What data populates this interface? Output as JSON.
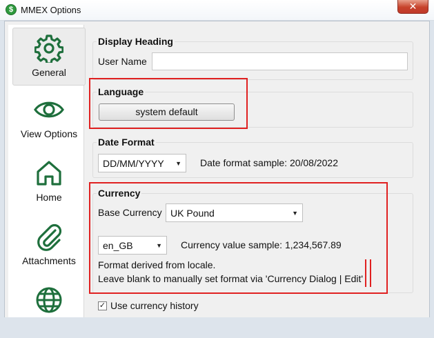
{
  "window": {
    "title": "MMEX Options",
    "close_glyph": "✕",
    "app_icon_glyph": "$"
  },
  "sidebar": {
    "items": [
      {
        "label": "General",
        "icon": "gear-icon",
        "active": true
      },
      {
        "label": "View Options",
        "icon": "eye-icon",
        "active": false
      },
      {
        "label": "Home",
        "icon": "home-icon",
        "active": false
      },
      {
        "label": "Attachments",
        "icon": "paperclip-icon",
        "active": false
      },
      {
        "label": "",
        "icon": "globe-icon",
        "active": false
      }
    ],
    "icon_color": "#1e6f3c"
  },
  "display_heading": {
    "title": "Display Heading",
    "user_name_label": "User Name",
    "user_name_value": ""
  },
  "language": {
    "title": "Language",
    "button_label": "system default"
  },
  "date_format": {
    "title": "Date Format",
    "selected": "DD/MM/YYYY",
    "sample": "Date format sample: 20/08/2022"
  },
  "currency": {
    "title": "Currency",
    "base_currency_label": "Base Currency",
    "base_currency_value": "UK Pound",
    "locale_value": "en_GB",
    "value_sample": "Currency value sample: 1,234,567.89",
    "note_line1": "Format derived from locale.",
    "note_line2": "Leave blank to manually set format via 'Currency Dialog | Edit'"
  },
  "currency_history": {
    "label": "Use currency history",
    "checked": true,
    "check_glyph": "✓"
  },
  "annotation_color": "#e02020"
}
